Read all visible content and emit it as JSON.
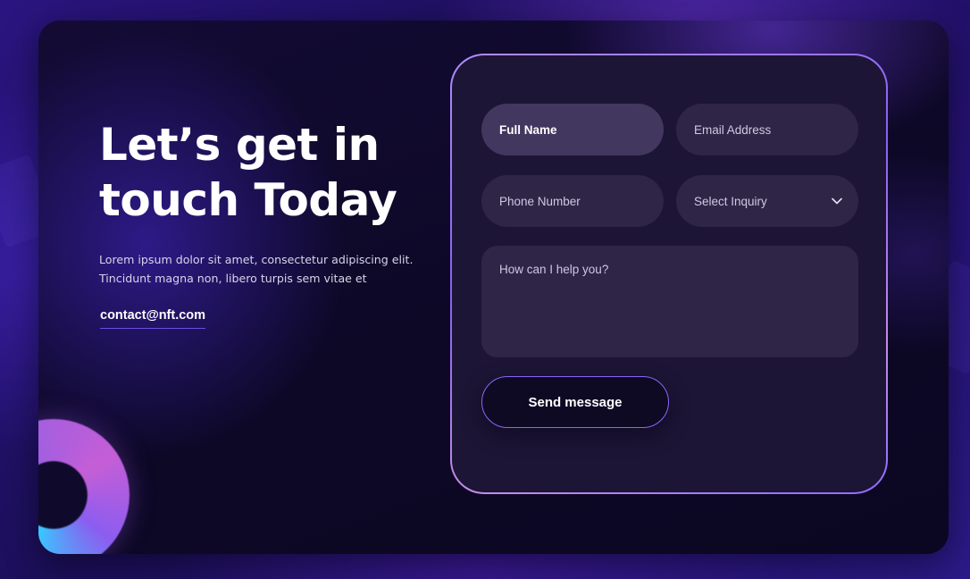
{
  "hero": {
    "headline": "Let’s get in touch Today",
    "lead": "Lorem ipsum dolor sit amet, consectetur adipiscing elit. Tincidunt magna non, libero turpis sem vitae et",
    "email": "contact@nft.com"
  },
  "form": {
    "full_name_placeholder": "Full Name",
    "email_placeholder": "Email Address",
    "phone_placeholder": "Phone Number",
    "inquiry_placeholder": "Select Inquiry",
    "message_placeholder": "How can I help you?",
    "submit_label": "Send message"
  },
  "icons": {
    "inquiry_dropdown": "chevron-down-icon",
    "decorative_ring": "gradient-ring"
  },
  "colors": {
    "accent": "#8b66f2",
    "panel": "#1c1535",
    "field": "#2e2547",
    "field_active": "#42375f"
  }
}
